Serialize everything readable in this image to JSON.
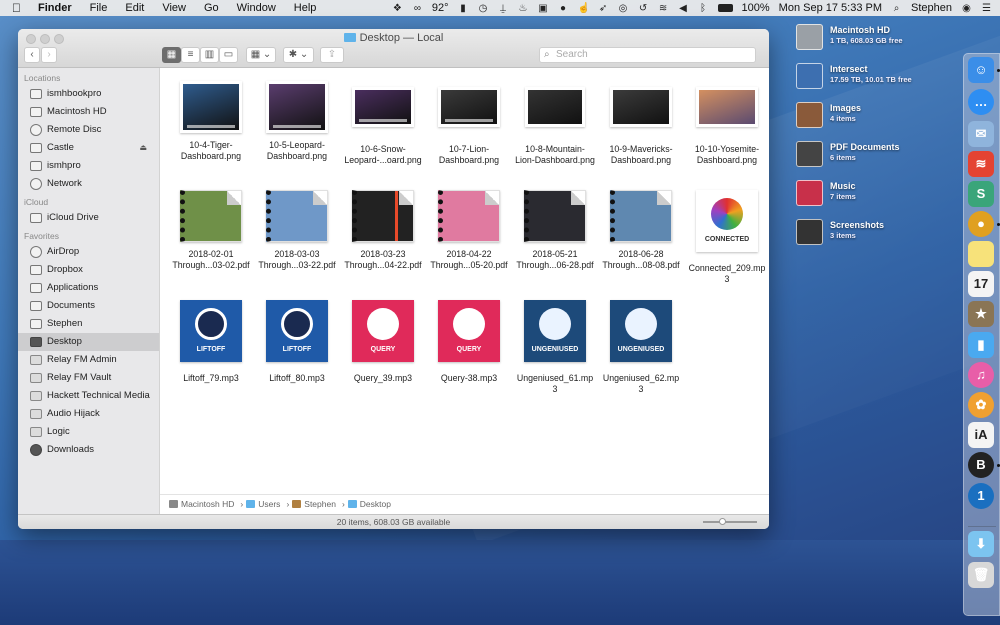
{
  "menubar": {
    "app_name": "Finder",
    "menus": [
      "File",
      "Edit",
      "View",
      "Go",
      "Window",
      "Help"
    ],
    "status_icons": [
      "dropbox-icon",
      "creative-cloud-icon",
      "weather-icon",
      "phone-icon",
      "clock-icon",
      "sling-icon",
      "flame-icon",
      "q-icon",
      "leaf-icon",
      "hand-icon",
      "rocket-icon",
      "one-password-icon",
      "time-machine-icon",
      "wifi-icon",
      "volume-icon",
      "bluetooth-icon",
      "battery-icon"
    ],
    "temperature": "92°",
    "battery": "100%",
    "datetime": "Mon Sep 17  5:33 PM",
    "user": "Stephen"
  },
  "window": {
    "title": "Desktop — Local",
    "search_placeholder": "Search",
    "view_modes": [
      "icon-view",
      "list-view",
      "column-view",
      "gallery-view"
    ],
    "active_view": "icon-view",
    "back_label": "‹",
    "forward_label": "›"
  },
  "sidebar": {
    "sections": [
      {
        "heading": "Locations",
        "items": [
          {
            "label": "ismhbookpro",
            "icon": "laptop-icon"
          },
          {
            "label": "Macintosh HD",
            "icon": "hard-drive-icon"
          },
          {
            "label": "Remote Disc",
            "icon": "disc-icon"
          },
          {
            "label": "Castle",
            "icon": "network-drive-icon",
            "eject": "⏏"
          },
          {
            "label": "ismhpro",
            "icon": "desktop-computer-icon"
          },
          {
            "label": "Network",
            "icon": "globe-icon"
          }
        ]
      },
      {
        "heading": "iCloud",
        "items": [
          {
            "label": "iCloud Drive",
            "icon": "cloud-icon"
          }
        ]
      },
      {
        "heading": "Favorites",
        "items": [
          {
            "label": "AirDrop",
            "icon": "airdrop-icon"
          },
          {
            "label": "Dropbox",
            "icon": "dropbox-icon"
          },
          {
            "label": "Applications",
            "icon": "applications-icon"
          },
          {
            "label": "Documents",
            "icon": "documents-icon"
          },
          {
            "label": "Stephen",
            "icon": "home-icon"
          },
          {
            "label": "Desktop",
            "icon": "desktop-folder-icon",
            "selected": true
          },
          {
            "label": "Relay FM Admin",
            "icon": "folder-icon"
          },
          {
            "label": "Relay FM Vault",
            "icon": "folder-icon"
          },
          {
            "label": "Hackett Technical Media",
            "icon": "folder-icon"
          },
          {
            "label": "Audio Hijack",
            "icon": "folder-icon"
          },
          {
            "label": "Logic",
            "icon": "folder-icon"
          },
          {
            "label": "Downloads",
            "icon": "downloads-icon"
          }
        ]
      }
    ]
  },
  "files": [
    {
      "name": "10-4-Tiger-Dashboard.png",
      "line1": "10-4-Tiger-",
      "line2": "Dashboard.png",
      "kind": "screenshot",
      "color": "#2f5c8e"
    },
    {
      "name": "10-5-Leopard-Dashboard.png",
      "line1": "10-5-Leopard-",
      "line2": "Dashboard.png",
      "kind": "screenshot",
      "color": "#5a3d6e"
    },
    {
      "name": "10-6-Snow-Leopard-...oard.png",
      "line1": "10-6-Snow-",
      "line2": "Leopard-...oard.png",
      "kind": "screenshot",
      "color": "#4a2e5e"
    },
    {
      "name": "10-7-Lion-Dashboard.png",
      "line1": "10-7-Lion-",
      "line2": "Dashboard.png",
      "kind": "screenshot",
      "color": "#3a3a3a"
    },
    {
      "name": "10-8-Mountain-Lion-Dashboard.png",
      "line1": "10-8-Mountain-",
      "line2": "Lion-Dashboard.png",
      "kind": "screenshot",
      "color": "#333333"
    },
    {
      "name": "10-9-Mavericks-Dashboard.png",
      "line1": "10-9-Mavericks-",
      "line2": "Dashboard.png",
      "kind": "screenshot",
      "color": "#3b3b3b"
    },
    {
      "name": "10-10-Yosemite-Dashboard.png",
      "line1": "10-10-Yosemite-",
      "line2": "Dashboard.png",
      "kind": "screenshot",
      "color": "#b07050"
    },
    {
      "name": "2018-02-01 Through...03-02.pdf",
      "line1": "2018-02-01",
      "line2": "Through...03-02.pdf",
      "kind": "pdf",
      "color": "#6f9048"
    },
    {
      "name": "2018-03-03 Through...03-22.pdf",
      "line1": "2018-03-03",
      "line2": "Through...03-22.pdf",
      "kind": "pdf",
      "color": "#6f98c8"
    },
    {
      "name": "2018-03-23 Through...04-22.pdf",
      "line1": "2018-03-23",
      "line2": "Through...04-22.pdf",
      "kind": "pdf",
      "color": "#222222"
    },
    {
      "name": "2018-04-22 Through...05-20.pdf",
      "line1": "2018-04-22",
      "line2": "Through...05-20.pdf",
      "kind": "pdf",
      "color": "#e07aa0"
    },
    {
      "name": "2018-05-21 Through...06-28.pdf",
      "line1": "2018-05-21",
      "line2": "Through...06-28.pdf",
      "kind": "pdf",
      "color": "#2a2a30"
    },
    {
      "name": "2018-06-28 Through...08-08.pdf",
      "line1": "2018-06-28",
      "line2": "Through...08-08.pdf",
      "kind": "pdf",
      "color": "#5f88b0"
    },
    {
      "name": "Connected_209.mp3",
      "line1": "Connected_209.mp",
      "line2": "3",
      "kind": "podcast",
      "color": "#ffffff",
      "art_text": "CONNECTED",
      "art_color": "#333333"
    },
    {
      "name": "Liftoff_79.mp3",
      "line1": "Liftoff_79.mp3",
      "line2": "",
      "kind": "podcast",
      "color": "#1f5aa8",
      "art_text": "LIFTOFF",
      "art_color": "#ffffff"
    },
    {
      "name": "Liftoff_80.mp3",
      "line1": "Liftoff_80.mp3",
      "line2": "",
      "kind": "podcast",
      "color": "#1f5aa8",
      "art_text": "LIFTOFF",
      "art_color": "#ffffff"
    },
    {
      "name": "Query_39.mp3",
      "line1": "Query_39.mp3",
      "line2": "",
      "kind": "podcast",
      "color": "#e02a5a",
      "art_text": "QUERY",
      "art_color": "#ffffff"
    },
    {
      "name": "Query-38.mp3",
      "line1": "Query-38.mp3",
      "line2": "",
      "kind": "podcast",
      "color": "#e02a5a",
      "art_text": "QUERY",
      "art_color": "#ffffff"
    },
    {
      "name": "Ungeniused_61.mp3",
      "line1": "Ungeniused_61.mp",
      "line2": "3",
      "kind": "podcast",
      "color": "#1d4a7a",
      "art_text": "UNGENIUSED",
      "art_color": "#ffffff"
    },
    {
      "name": "Ungeniused_62.mp3",
      "line1": "Ungeniused_62.mp",
      "line2": "3",
      "kind": "podcast",
      "color": "#1d4a7a",
      "art_text": "UNGENIUSED",
      "art_color": "#ffffff"
    }
  ],
  "pathbar": [
    "Macintosh HD",
    "Users",
    "Stephen",
    "Desktop"
  ],
  "pathbar_separator": "›",
  "status": "20 items, 608.03 GB available",
  "icon_size_slider": 0.35,
  "desktop_items": [
    {
      "name": "Macintosh HD",
      "sub": "1 TB, 608.03 GB free",
      "icon": "hard-drive-icon",
      "color": "#9aa0a6"
    },
    {
      "name": "Intersect",
      "sub": "17.59 TB, 10.01 TB free",
      "icon": "server-drive-icon",
      "color": "#3d6fb0"
    },
    {
      "name": "Images",
      "sub": "4 items",
      "icon": "images-stack-icon",
      "color": "#8a5a3a"
    },
    {
      "name": "PDF Documents",
      "sub": "6 items",
      "icon": "pdf-stack-icon",
      "color": "#444444"
    },
    {
      "name": "Music",
      "sub": "7 items",
      "icon": "music-stack-icon",
      "color": "#c8304a"
    },
    {
      "name": "Screenshots",
      "sub": "3 items",
      "icon": "screenshots-stack-icon",
      "color": "#333333"
    }
  ],
  "dock": [
    {
      "name": "finder",
      "glyph": "☺",
      "color": "#3b8ee8",
      "running": true
    },
    {
      "name": "messages",
      "glyph": "…",
      "color": "#2e8ef2",
      "running": false
    },
    {
      "name": "mail",
      "glyph": "✉",
      "color": "#8fb4dc",
      "running": false
    },
    {
      "name": "todoist",
      "glyph": "≋",
      "color": "#e44332",
      "running": false
    },
    {
      "name": "slack",
      "glyph": "S",
      "color": "#3aa57a",
      "running": false
    },
    {
      "name": "chrome",
      "glyph": "●",
      "color": "#e0a020",
      "running": true
    },
    {
      "name": "notes",
      "glyph": "",
      "color": "#f7e27a",
      "running": false
    },
    {
      "name": "calendar",
      "glyph": "17",
      "color": "#f4f4f4",
      "running": false
    },
    {
      "name": "deliveries",
      "glyph": "★",
      "color": "#8a7555",
      "running": false
    },
    {
      "name": "day-one",
      "glyph": "▮",
      "color": "#4aa9f0",
      "running": false
    },
    {
      "name": "itunes",
      "glyph": "♫",
      "color": "#e85ea8",
      "running": false
    },
    {
      "name": "photos",
      "glyph": "✿",
      "color": "#f0a030",
      "running": false
    },
    {
      "name": "ia-writer",
      "glyph": "iA",
      "color": "#f4f4f4",
      "running": false
    },
    {
      "name": "bear",
      "glyph": "B",
      "color": "#222222",
      "running": true
    },
    {
      "name": "one-password",
      "glyph": "1",
      "color": "#1a6fc0",
      "running": false
    },
    {
      "name": "downloads",
      "glyph": "⬇",
      "color": "#7cc4f0",
      "running": false
    },
    {
      "name": "trash",
      "glyph": "🗑",
      "color": "#d8d8d8",
      "running": false
    }
  ]
}
